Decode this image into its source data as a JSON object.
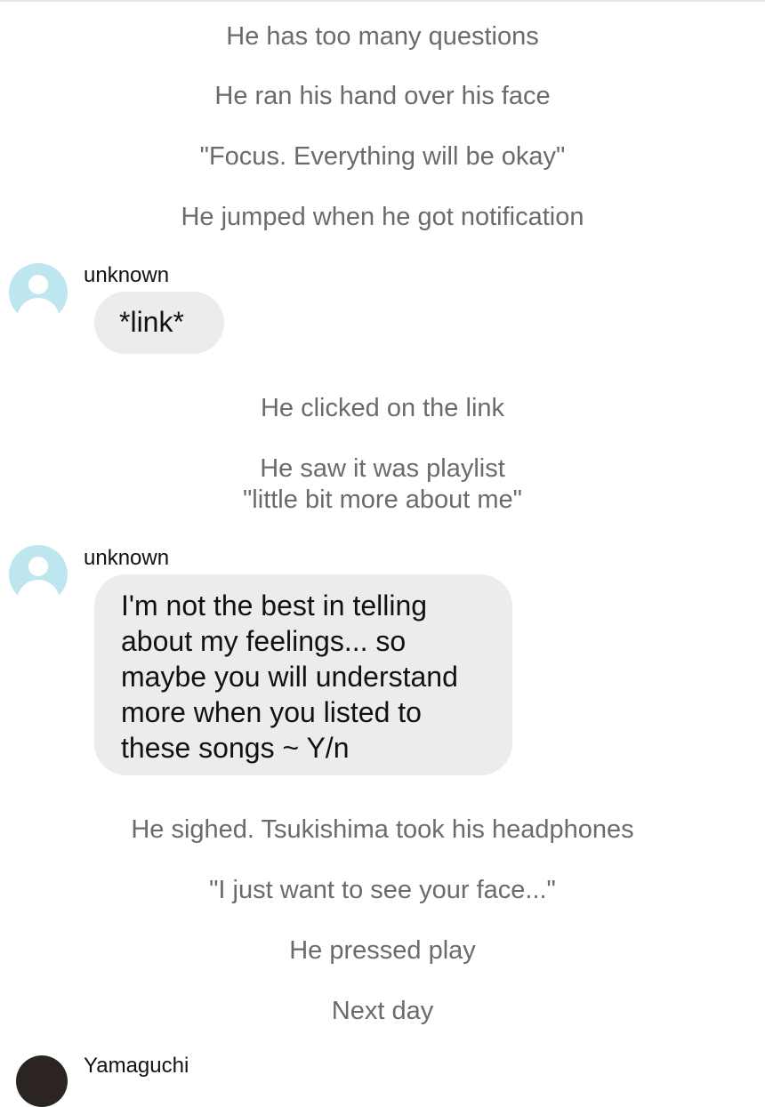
{
  "messages": {
    "narration_1": "He has too many questions",
    "narration_2": "He ran his hand over his face",
    "narration_3": "\"Focus. Everything will be okay\"",
    "narration_4": "He jumped when he got notification",
    "chat_1": {
      "sender": "unknown",
      "text": "*link*"
    },
    "narration_5": "He clicked on the link",
    "narration_6_line1": "He saw it was playlist",
    "narration_6_line2": "\"little bit more about me\"",
    "chat_2": {
      "sender": "unknown",
      "text": "I'm not the best in telling\nabout my feelings... so\nmaybe you will understand\nmore when you listed to\nthese songs ~ Y/n"
    },
    "narration_7": "He sighed. Tsukishima took his headphones",
    "narration_8": "\"I just want to see your face...\"",
    "narration_9": "He pressed play",
    "narration_10": "Next day",
    "chat_3": {
      "sender": "Yamaguchi"
    }
  },
  "icons": {
    "default_avatar": "person-placeholder-icon"
  },
  "colors": {
    "narration_text": "#6b6b6b",
    "bubble_background": "#ececec",
    "avatar_background": "#bde6ee",
    "message_text": "#111111"
  }
}
